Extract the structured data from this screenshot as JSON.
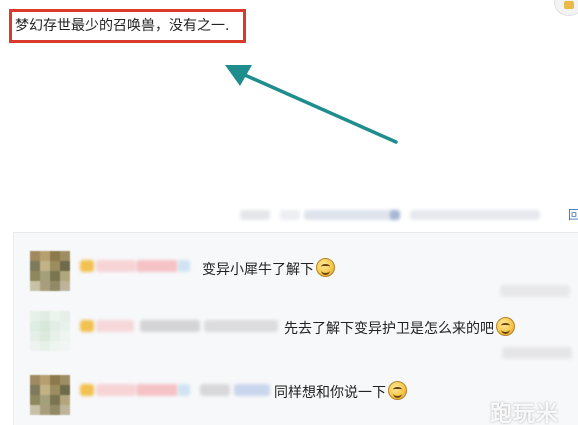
{
  "post": {
    "text": "梦幻存世最少的召唤兽，没有之一."
  },
  "annotation": {
    "highlight_color": "#d93a2b",
    "arrow_color": "#1f8d8d"
  },
  "meta_bar": {
    "link_glyph": "回"
  },
  "comments": [
    {
      "text": "变异小犀牛了解下",
      "emoji": "smile-emoji"
    },
    {
      "text": "先去了解下变异护卫是怎么来的吧",
      "emoji": "smile-emoji"
    },
    {
      "text": "同样想和你说一下",
      "emoji": "smile-emoji"
    }
  ],
  "watermark": "跑玩米"
}
